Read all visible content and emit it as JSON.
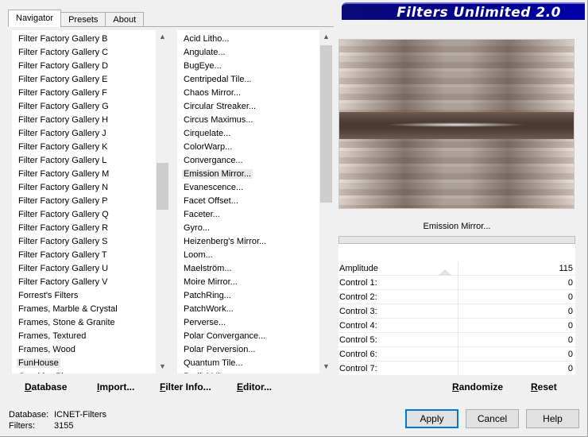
{
  "tabs": [
    {
      "label": "Navigator",
      "active": true
    },
    {
      "label": "Presets",
      "active": false
    },
    {
      "label": "About",
      "active": false
    }
  ],
  "banner": {
    "title": "Filters Unlimited 2.0"
  },
  "categories": {
    "items": [
      "Filter Factory Gallery B",
      "Filter Factory Gallery C",
      "Filter Factory Gallery D",
      "Filter Factory Gallery E",
      "Filter Factory Gallery F",
      "Filter Factory Gallery G",
      "Filter Factory Gallery H",
      "Filter Factory Gallery J",
      "Filter Factory Gallery K",
      "Filter Factory Gallery L",
      "Filter Factory Gallery M",
      "Filter Factory Gallery N",
      "Filter Factory Gallery P",
      "Filter Factory Gallery Q",
      "Filter Factory Gallery R",
      "Filter Factory Gallery S",
      "Filter Factory Gallery T",
      "Filter Factory Gallery U",
      "Filter Factory Gallery V",
      "Forrest's Filters",
      "Frames, Marble & Crystal",
      "Frames, Stone & Granite",
      "Frames, Textured",
      "Frames, Wood",
      "FunHouse",
      "Graphics Plus"
    ],
    "selected": "FunHouse"
  },
  "filters": {
    "items": [
      "Acid Litho...",
      "Angulate...",
      "BugEye...",
      "Centripedal Tile...",
      "Chaos Mirror...",
      "Circular Streaker...",
      "Circus Maximus...",
      "Cirquelate...",
      "ColorWarp...",
      "Convergance...",
      "Emission Mirror...",
      "Evanescence...",
      "Facet Offset...",
      "Faceter...",
      "Gyro...",
      "Heizenberg's Mirror...",
      "Loom...",
      "Maelström...",
      "Moire Mirror...",
      "PatchRing...",
      "PatchWork...",
      "Perverse...",
      "Polar Convergance...",
      "Polar Perversion...",
      "Quantum Tile...",
      "Radial Mirror..."
    ],
    "selected": "Emission Mirror..."
  },
  "selected_filter_name": "Emission Mirror...",
  "controls": [
    {
      "label": "Amplitude",
      "value": "115",
      "level": 0.45
    },
    {
      "label": "Control 1:",
      "value": "0"
    },
    {
      "label": "Control 2:",
      "value": "0"
    },
    {
      "label": "Control 3:",
      "value": "0"
    },
    {
      "label": "Control 4:",
      "value": "0"
    },
    {
      "label": "Control 5:",
      "value": "0"
    },
    {
      "label": "Control 6:",
      "value": "0"
    },
    {
      "label": "Control 7:",
      "value": "0"
    }
  ],
  "actions_left": [
    {
      "label": "Database",
      "name": "database-button"
    },
    {
      "label": "Import...",
      "name": "import-button"
    },
    {
      "label": "Filter Info...",
      "name": "filter-info-button"
    },
    {
      "label": "Editor...",
      "name": "editor-button"
    }
  ],
  "actions_right": [
    {
      "label": "Randomize",
      "name": "randomize-button"
    },
    {
      "label": "Reset",
      "name": "reset-button"
    }
  ],
  "status": {
    "database_label": "Database:",
    "database_value": "ICNET-Filters",
    "filters_label": "Filters:",
    "filters_value": "3155"
  },
  "buttons": {
    "apply": "Apply",
    "cancel": "Cancel",
    "help": "Help"
  },
  "colors": {
    "banner": "#000090",
    "default_button_border": "#0078d7"
  }
}
